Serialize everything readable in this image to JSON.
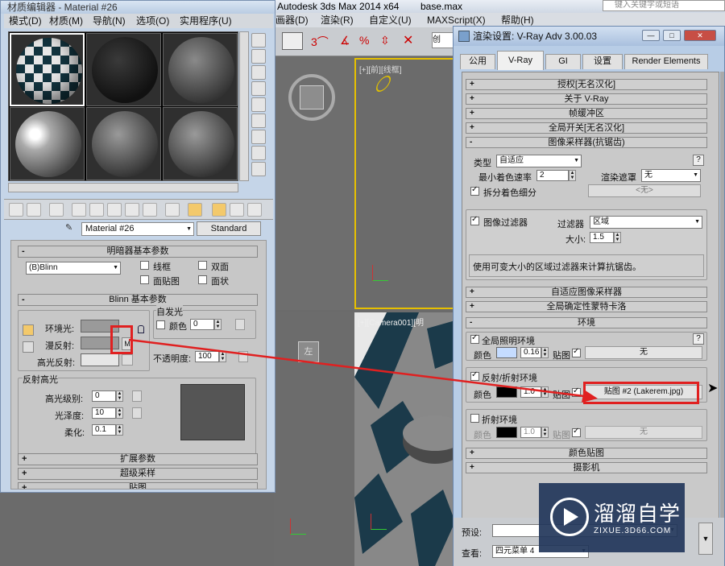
{
  "max": {
    "title": "Autodesk 3ds Max  2014 x64",
    "file": "base.max",
    "search_placeholder": "键入关键字或短语",
    "menu": [
      "画器(D)",
      "渲染(R)",
      "自定义(U)",
      "MAXScript(X)",
      "帮助(H)"
    ],
    "viewport_front_label": "[+][前][线框]",
    "viewport_camera_label": "[+][Camera001][明"
  },
  "material_editor": {
    "title": "材质编辑器 - Material #26",
    "menu": [
      "模式(D)",
      "材质(M)",
      "导航(N)",
      "选项(O)",
      "实用程序(U)"
    ],
    "material_name": "Material #26",
    "type_button": "Standard",
    "shader_rollout": "明暗器基本参数",
    "shader_type": "(B)Blinn",
    "shader_opts": [
      "线框",
      "双面",
      "面贴图",
      "面状"
    ],
    "blinn_rollout": "Blinn 基本参数",
    "self_illum_group": "自发光",
    "self_illum_color_label": "颜色",
    "self_illum_value": "0",
    "ambient_label": "环境光:",
    "diffuse_label": "漫反射:",
    "specular_label": "高光反射:",
    "map_button": "M",
    "opacity_label": "不透明度:",
    "opacity_value": "100",
    "spec_group": "反射高光",
    "spec_level_label": "高光级别:",
    "spec_level_value": "0",
    "gloss_label": "光泽度:",
    "gloss_value": "10",
    "soften_label": "柔化:",
    "soften_value": "0.1",
    "rollouts_bottom": [
      "扩展参数",
      "超级采样",
      "贴图"
    ],
    "colors": {
      "ambient": "#9a9a9a",
      "diffuse": "#9a9a9a",
      "specular": "#e6e6e6",
      "highlight_preview": "#555555"
    }
  },
  "vray": {
    "title": "渲染设置: V-Ray Adv 3.00.03",
    "tabs": [
      "公用",
      "V-Ray",
      "GI",
      "设置",
      "Render Elements"
    ],
    "active_tab": "V-Ray",
    "rollouts_top": [
      "授权[无名汉化]",
      "关于 V-Ray",
      "帧缓冲区",
      "全局开关[无名汉化]",
      "图像采样器(抗锯齿)"
    ],
    "sampler_type_label": "类型",
    "sampler_type": "自适应",
    "min_shading_label": "最小着色速率",
    "min_shading_value": "2",
    "render_mask_label": "渲染遮罩",
    "render_mask_value": "无",
    "divide_shading_label": "拆分着色细分",
    "none_button": "<无>",
    "image_filter_label": "图像过滤器",
    "filter_label": "过滤器",
    "filter_value": "区域",
    "size_label": "大小:",
    "size_value": "1.5",
    "filter_desc": "使用可变大小的区域过滤器来计算抗锯齿。",
    "rollouts_mid": [
      "自适应图像采样器",
      "全局确定性蒙特卡洛",
      "环境"
    ],
    "gi_env_label": "全局照明环境",
    "color_label": "颜色",
    "gi_multiplier": "0.16",
    "map_label": "贴图",
    "gi_map": "无",
    "refl_env_label": "反射/折射环境",
    "refl_multiplier": "1.0",
    "refl_map": "贴图 #2 (Lakerem.jpg)",
    "refr_env_label": "折射环境",
    "refr_multiplier": "1.0",
    "refr_map": "无",
    "rollouts_bottom": [
      "颜色贴图",
      "摄影机"
    ],
    "preset_label": "预设:",
    "view_label": "查看:",
    "view_value": "四元菜单 4",
    "colors": {
      "gi_color": "#c5dcff",
      "refl_color": "#000000",
      "refr_color": "#000000"
    }
  },
  "watermark": {
    "brand": "溜溜自学",
    "url": "ZIXUE.3D66.COM"
  }
}
